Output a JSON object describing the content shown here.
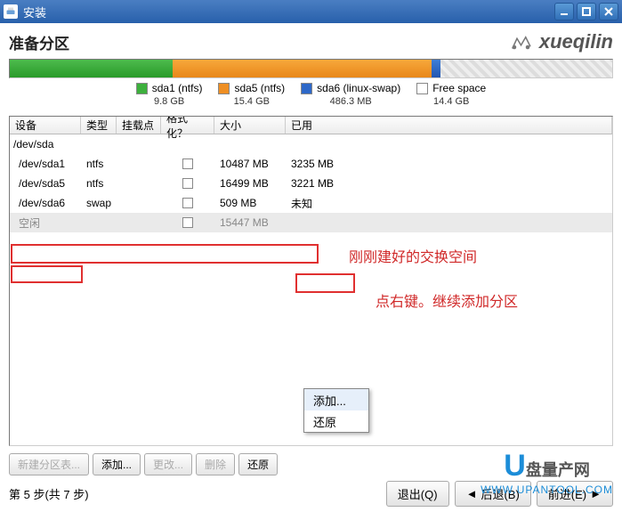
{
  "window": {
    "title": "安装"
  },
  "header": {
    "title": "准备分区",
    "brand": "xueqilin"
  },
  "bar": {
    "segments": [
      {
        "cls": "seg-green",
        "pct": 27
      },
      {
        "cls": "seg-orange",
        "pct": 43
      },
      {
        "cls": "seg-blue",
        "pct": 1.5
      },
      {
        "cls": "seg-free",
        "pct": 28.5
      }
    ]
  },
  "legend": [
    {
      "sw": "sw-green",
      "label": "sda1 (ntfs)",
      "size": "9.8 GB"
    },
    {
      "sw": "sw-orange",
      "label": "sda5 (ntfs)",
      "size": "15.4 GB"
    },
    {
      "sw": "sw-blue",
      "label": "sda6 (linux-swap)",
      "size": "486.3 MB"
    },
    {
      "sw": "sw-free",
      "label": "Free space",
      "size": "14.4 GB"
    }
  ],
  "columns": {
    "dev": "设备",
    "type": "类型",
    "mnt": "挂载点",
    "fmt": "格式化？",
    "size": "大小",
    "used": "已用"
  },
  "rows": [
    {
      "dev": "/dev/sda",
      "disk": true
    },
    {
      "dev": "/dev/sda1",
      "type": "ntfs",
      "fmt": false,
      "size": "10487 MB",
      "used": "3235 MB"
    },
    {
      "dev": "/dev/sda5",
      "type": "ntfs",
      "fmt": false,
      "size": "16499 MB",
      "used": "3221 MB"
    },
    {
      "dev": "/dev/sda6",
      "type": "swap",
      "fmt": false,
      "size": "509 MB",
      "used": "未知"
    },
    {
      "dev": "空闲",
      "free": true,
      "fmt": false,
      "size": "15447 MB"
    }
  ],
  "context_menu": {
    "add": "添加...",
    "restore": "还原"
  },
  "annotations": {
    "swap": "刚刚建好的交换空间",
    "add": "点右键。继续添加分区"
  },
  "buttons": {
    "new_table": "新建分区表...",
    "add": "添加...",
    "edit": "更改...",
    "delete": "删除",
    "restore": "还原"
  },
  "footer": {
    "step": "第 5 步(共 7 步)",
    "quit": "退出(Q)",
    "back": "后退(B)",
    "forward": "前进(E)"
  },
  "overlay": {
    "brand": "盘量产网",
    "url": "WWW.UPANTOOL.COM"
  }
}
